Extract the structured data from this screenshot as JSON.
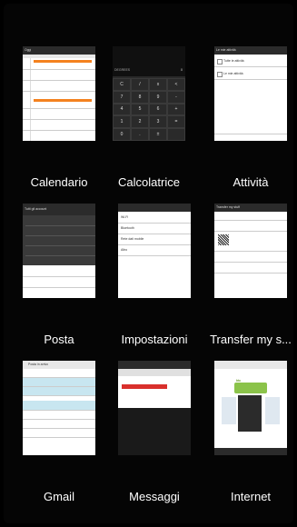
{
  "apps": [
    {
      "label": "Calendario",
      "thumb": "calendar-thumbnail",
      "header": "Oggi",
      "event_color": "#f4821f"
    },
    {
      "label": "Calcolatrice",
      "thumb": "calculator-thumbnail",
      "display_mode": "DEGREES",
      "display_value": "0",
      "keys": [
        "C",
        "/",
        "x",
        "<",
        "7",
        "8",
        "9",
        "-",
        "4",
        "5",
        "6",
        "+",
        "1",
        "2",
        "3",
        "=",
        "0",
        ".",
        "±",
        ""
      ]
    },
    {
      "label": "Attività",
      "thumb": "tasks-thumbnail",
      "header": "Le mie attività",
      "items": [
        "Tutte le attività",
        "Le mie attività"
      ]
    },
    {
      "label": "Posta",
      "thumb": "mail-thumbnail",
      "header": "Tutti gli account",
      "accent": "#f4821f"
    },
    {
      "label": "Impostazioni",
      "thumb": "settings-thumbnail",
      "items": [
        "Wi-Fi",
        "Bluetooth",
        "Rete dati mobile",
        "Altro"
      ]
    },
    {
      "label": "Transfer my s...",
      "thumb": "transfer-thumbnail",
      "header": "Transfer my stuff"
    },
    {
      "label": "Gmail",
      "thumb": "gmail-thumbnail",
      "header": "Posta in arrivo",
      "accent": "#c8e6f0"
    },
    {
      "label": "Messaggi",
      "thumb": "messages-thumbnail",
      "header": "Messaggi",
      "accent": "#d9302c"
    },
    {
      "label": "Internet",
      "thumb": "internet-thumbnail",
      "header": "htc",
      "accent": "#8bc34a"
    }
  ]
}
